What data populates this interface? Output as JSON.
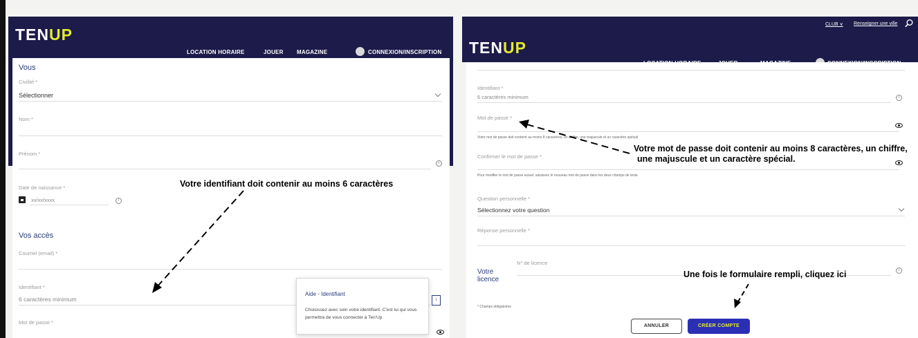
{
  "left": {
    "header": {
      "logo_a": "TEN",
      "logo_b": "UP",
      "nav": [
        "LOCATION HORAIRE",
        "JOUER",
        "MAGAZINE"
      ],
      "login": "CONNEXION/INSCRIPTION"
    },
    "form": {
      "section_you": "Vous",
      "civility_label": "Civilité *",
      "civility_value": "Sélectionner",
      "name_label": "Nom *",
      "firstname_label": "Prénom *",
      "birthdate_label": "Date de naissance *",
      "birthdate_placeholder": "xx/xx/xxxx",
      "section_access": "Vos accès",
      "email_label": "Courriel (email) *",
      "identifier_label": "Identifiant *",
      "identifier_placeholder": "6 caractères minimum",
      "password_label": "Mot de passe *"
    },
    "tooltip": {
      "title": "Aide - Identifiant",
      "body": "Choisissez avec soin votre identifiant. C'est lui qui vous permettra de vous connecter à Ten'Up"
    },
    "annotation": "Votre identifiant doit contenir au moins 6 caractères"
  },
  "right": {
    "topbar": {
      "club": "CLUB",
      "city": "Renseigner une ville"
    },
    "header": {
      "logo_a": "TEN",
      "logo_b": "UP",
      "nav": [
        "LOCATION HORAIRE",
        "JOUER",
        "MAGAZINE"
      ],
      "login": "CONNEXION/INSCRIPTION"
    },
    "form": {
      "identifier_label": "Identifiant *",
      "identifier_placeholder": "6 caractères minimum",
      "password_label": "Mot de passe *",
      "password_hint": "Votre mot de passe doit contenir au moins 8 caractères, un chiffre, une majuscule et un caractère spécial",
      "confirm_label": "Confirmer le mot de passe *",
      "confirm_hint": "Pour modifier le mot de passe actuel, saisissez le nouveau mot de passe dans les deux champs de texte",
      "question_label": "Question personnelle *",
      "question_value": "Sélectionnez votre question",
      "answer_label": "Réponse personnelle *",
      "licence_title_1": "Votre",
      "licence_title_2": "licence",
      "licence_label": "N° de licence",
      "required_note": "* Champs obligatoires",
      "cancel_button": "ANNULER",
      "create_button": "CRÉER COMPTE"
    },
    "annotation_password_1": "Votre mot de passe doit contenir au moins 8 caractères, un chiffre,",
    "annotation_password_2": "une majuscule et un caractère spécial.",
    "annotation_submit": "Une fois le formulaire rempli, cliquez ici"
  },
  "colors": {
    "header_bg": "#1c1b49",
    "logo_accent": "#e4ea2e",
    "section_title": "#283c7a",
    "primary_button": "#2b2fb6"
  },
  "icons": [
    "user-avatar-icon",
    "chevron-down-icon",
    "info-icon",
    "calendar-icon",
    "eye-icon",
    "search-icon"
  ]
}
